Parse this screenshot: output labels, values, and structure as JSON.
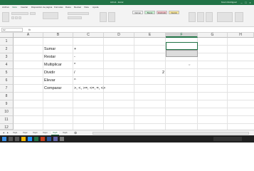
{
  "app": {
    "title": "Libro1 - Excel",
    "user": "Kevin Rodriguez",
    "win_min": "–",
    "win_max": "□",
    "win_close": "×"
  },
  "menu": [
    "Archivo",
    "Inicio",
    "Insertar",
    "Disposición de página",
    "Fórmulas",
    "Datos",
    "Revisar",
    "Vista",
    "Ayuda"
  ],
  "ribbon_styles": [
    {
      "label": "Normal",
      "bg": "#ffffff"
    },
    {
      "label": "Buena",
      "bg": "#c6efce"
    },
    {
      "label": "Incorrecto",
      "bg": "#ffc7ce"
    },
    {
      "label": "Neutral",
      "bg": "#ffeb9c"
    }
  ],
  "formula_bar": {
    "name_box": "F2",
    "fx": "fx",
    "value": ""
  },
  "columns": [
    "A",
    "B",
    "C",
    "D",
    "E",
    "F",
    "G",
    "H"
  ],
  "selected_column": "F",
  "rows": [
    "1",
    "2",
    "3",
    "4",
    "5",
    "6",
    "7",
    "8",
    "9",
    "10",
    "11",
    "12"
  ],
  "cells": {
    "b2": "Sumar",
    "c2": "+",
    "b3": "Restar",
    "c3": "-",
    "b4": "Multiplicar",
    "c4": "*",
    "b5": "Dividir",
    "c5": "/",
    "e5": "2",
    "b6": "Elevar",
    "c6": "^",
    "b7": "Comparar",
    "c7": ">, <, >=, <=, =, <>"
  },
  "sheet_tabs": [
    "Hoja1",
    "Hoja2",
    "Hoja3",
    "Hoja4",
    "Hoja5",
    "Hoja6"
  ],
  "active_sheet": "Hoja5",
  "colors": {
    "accent": "#217346",
    "taskbar": "#202020"
  }
}
